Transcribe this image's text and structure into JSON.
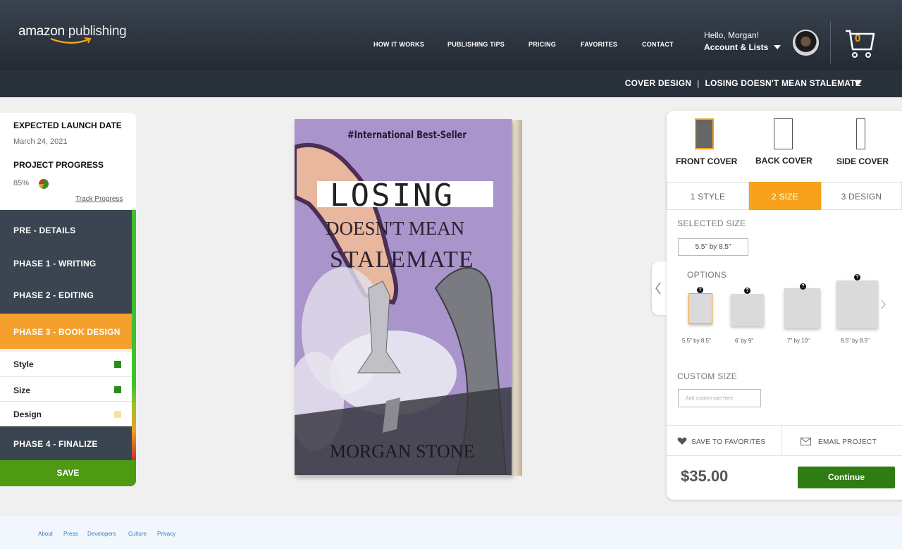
{
  "header": {
    "logo_main": "amazon",
    "logo_sub": "publishing",
    "nav": [
      "HOW IT WORKS",
      "PUBLISHING TIPS",
      "PRICING",
      "FAVORITES",
      "CONTACT"
    ],
    "greeting": "Hello, Morgan!",
    "account_label": "Account & Lists",
    "cart_count": "0"
  },
  "breadcrumb": {
    "section": "COVER DESIGN",
    "separator": "|",
    "project": "LOSING DOESN'T MEAN STALEMATE"
  },
  "sidebar": {
    "launch_label": "EXPECTED LAUNCH DATE",
    "launch_date": "March 24, 2021",
    "progress_label": "PROJECT PROGRESS",
    "progress_value": "85%",
    "track_link": "Track Progress",
    "phases": {
      "pre": "PRE - DETAILS",
      "p1": "PHASE 1 - WRITING",
      "p2": "PHASE 2 - EDITING",
      "p3": "PHASE 3 - BOOK DESIGN",
      "p4": "PHASE 4 - FINALIZE"
    },
    "subitems": [
      {
        "label": "Style",
        "status_color": "#2e8b1e"
      },
      {
        "label": "Size",
        "status_color": "#2e8b1e"
      },
      {
        "label": "Design",
        "status_color": "#f7e2a2"
      }
    ],
    "save_label": "SAVE"
  },
  "book": {
    "badge": "#International Best-Seller",
    "title_line1": "LOSING",
    "title_line2": "DOESN'T MEAN",
    "title_line3": "STALEMATE",
    "author": "MORGAN STONE"
  },
  "panel": {
    "covers": [
      "FRONT COVER",
      "BACK COVER",
      "SIDE COVER"
    ],
    "tabs": [
      "1 STYLE",
      "2 SIZE",
      "3 DESIGN"
    ],
    "selected_size_label": "SELECTED SIZE",
    "selected_size_value": "5.5\" by 8.5\"",
    "options_label": "OPTIONS",
    "options": [
      "5.5\" by 8.5\"",
      "6' by 9\"",
      "7\" by 10\"",
      "8.5\" by 8.5\""
    ],
    "help_glyph": "?",
    "custom_size_label": "CUSTOM SIZE",
    "custom_size_placeholder": "Add custom size here",
    "save_fav_label": "SAVE TO FAVORITES",
    "email_label": "EMAIL PROJECT",
    "price": "$35.00",
    "continue_label": "Continue"
  },
  "footer": {
    "links": [
      "About",
      "Press",
      "Developers",
      "Culture",
      "Privacy"
    ]
  },
  "colors": {
    "accent": "#f7a21a",
    "save_green": "#4e9a13",
    "continue_green": "#2f7d12",
    "header_dark": "#29313b"
  }
}
